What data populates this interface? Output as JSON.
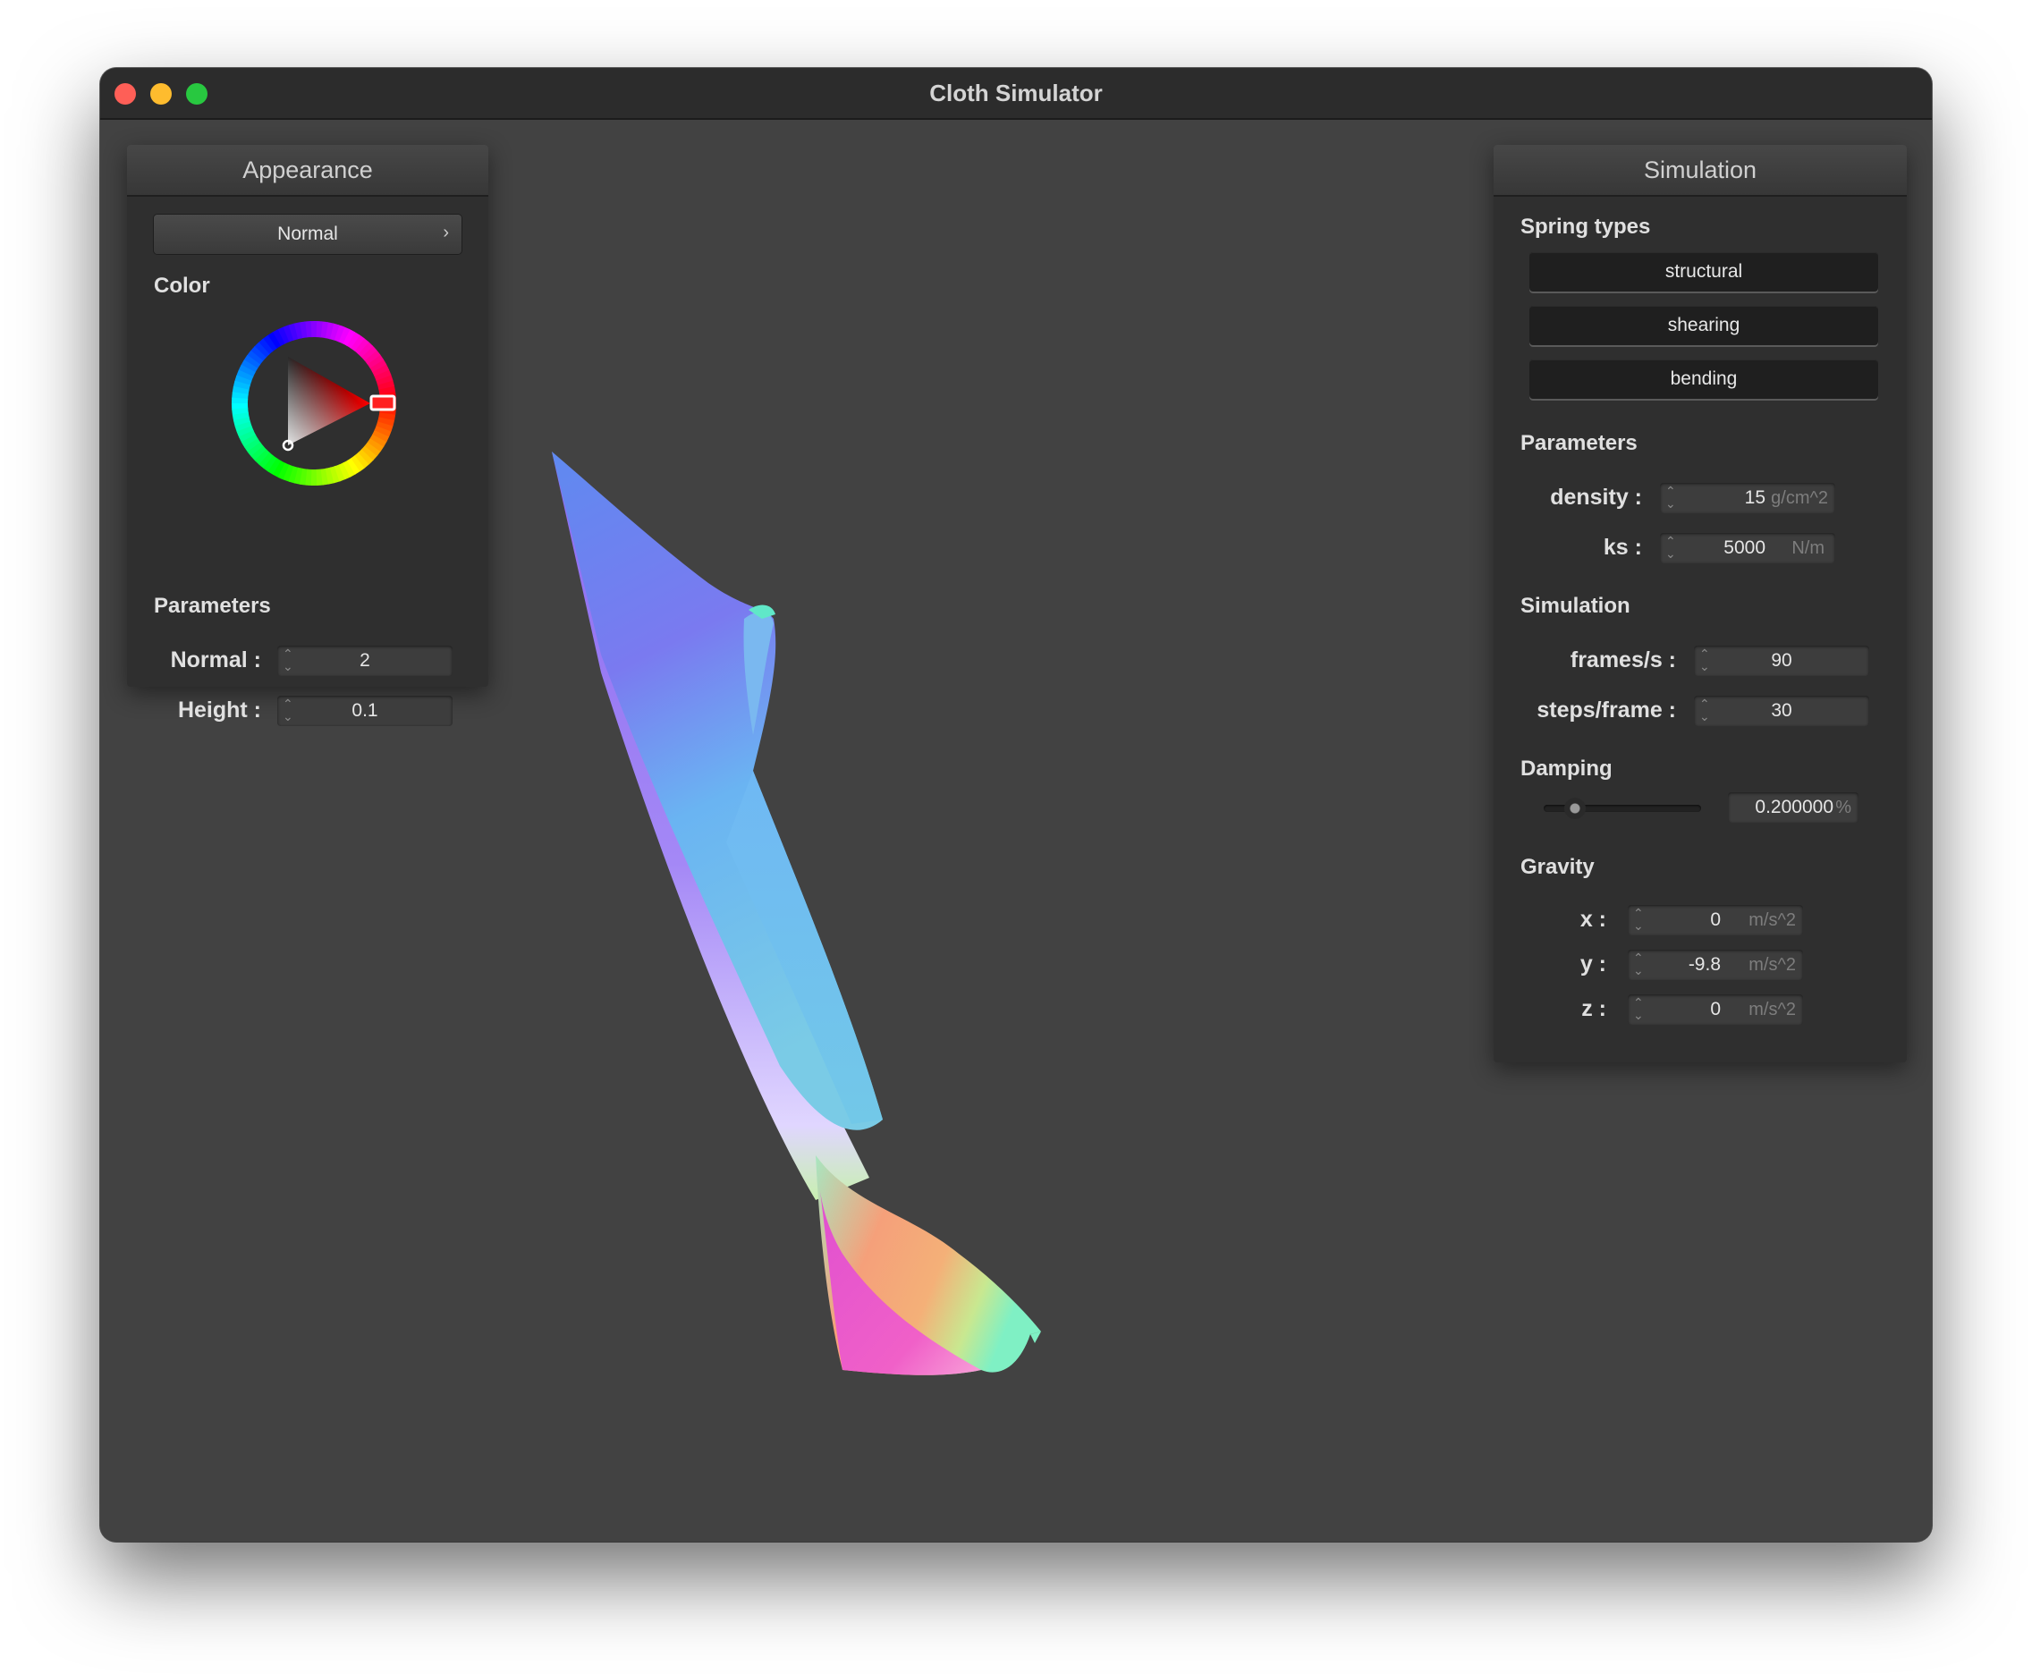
{
  "window": {
    "title": "Cloth Simulator"
  },
  "appearance": {
    "header": "Appearance",
    "shader": "Normal",
    "color_label": "Color",
    "selected_color": "#ff0000",
    "parameters_label": "Parameters",
    "normal": {
      "label": "Normal :",
      "value": "2"
    },
    "height": {
      "label": "Height :",
      "value": "0.1"
    }
  },
  "simulation_panel": {
    "header": "Simulation",
    "spring_types_label": "Spring types",
    "springs": [
      "structural",
      "shearing",
      "bending"
    ],
    "parameters_label": "Parameters",
    "density": {
      "label": "density :",
      "value": "15",
      "unit": "g/cm^2"
    },
    "ks": {
      "label": "ks :",
      "value": "5000",
      "unit": "N/m"
    },
    "simulation_label": "Simulation",
    "fps": {
      "label": "frames/s :",
      "value": "90"
    },
    "steps": {
      "label": "steps/frame :",
      "value": "30"
    },
    "damping_label": "Damping",
    "damping": {
      "value": "0.200000",
      "unit": "%",
      "slider_fraction": 0.2
    },
    "gravity_label": "Gravity",
    "gravity": [
      {
        "label": "x :",
        "value": "0",
        "unit": "m/s^2"
      },
      {
        "label": "y :",
        "value": "-9.8",
        "unit": "m/s^2"
      },
      {
        "label": "z :",
        "value": "0",
        "unit": "m/s^2"
      }
    ]
  }
}
